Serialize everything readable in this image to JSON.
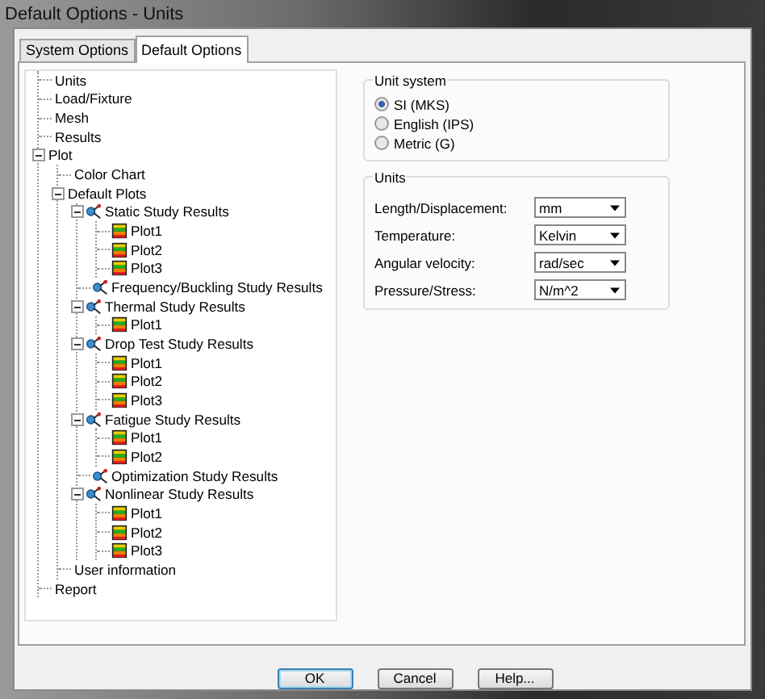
{
  "window": {
    "title": "Default Options - Units"
  },
  "tabs": [
    {
      "label": "System Options",
      "selected": false
    },
    {
      "label": "Default Options",
      "selected": true
    }
  ],
  "tree": [
    {
      "label": "Units"
    },
    {
      "label": "Load/Fixture"
    },
    {
      "label": "Mesh"
    },
    {
      "label": "Results"
    },
    {
      "label": "Plot",
      "expanded": true,
      "children": [
        {
          "label": "Color Chart"
        },
        {
          "label": "Default Plots",
          "expanded": true,
          "children": [
            {
              "label": "Static Study Results",
              "kind": "study",
              "expanded": true,
              "children": [
                {
                  "label": "Plot1",
                  "kind": "plot"
                },
                {
                  "label": "Plot2",
                  "kind": "plot"
                },
                {
                  "label": "Plot3",
                  "kind": "plot"
                }
              ]
            },
            {
              "label": "Frequency/Buckling Study Results",
              "kind": "study"
            },
            {
              "label": "Thermal Study Results",
              "kind": "study",
              "expanded": true,
              "children": [
                {
                  "label": "Plot1",
                  "kind": "plot"
                }
              ]
            },
            {
              "label": "Drop Test Study Results",
              "kind": "study",
              "expanded": true,
              "children": [
                {
                  "label": "Plot1",
                  "kind": "plot"
                },
                {
                  "label": "Plot2",
                  "kind": "plot"
                },
                {
                  "label": "Plot3",
                  "kind": "plot"
                }
              ]
            },
            {
              "label": "Fatigue Study Results",
              "kind": "study",
              "expanded": true,
              "children": [
                {
                  "label": "Plot1",
                  "kind": "plot"
                },
                {
                  "label": "Plot2",
                  "kind": "plot"
                }
              ]
            },
            {
              "label": "Optimization Study Results",
              "kind": "study"
            },
            {
              "label": "Nonlinear Study Results",
              "kind": "study",
              "expanded": true,
              "children": [
                {
                  "label": "Plot1",
                  "kind": "plot"
                },
                {
                  "label": "Plot2",
                  "kind": "plot"
                },
                {
                  "label": "Plot3",
                  "kind": "plot"
                }
              ]
            }
          ]
        },
        {
          "label": "User information"
        }
      ]
    },
    {
      "label": "Report"
    }
  ],
  "unit_system": {
    "title": "Unit system",
    "options": [
      {
        "label": "SI (MKS)",
        "selected": true
      },
      {
        "label": "English (IPS)",
        "selected": false
      },
      {
        "label": "Metric (G)",
        "selected": false
      }
    ]
  },
  "units": {
    "title": "Units",
    "rows": [
      {
        "label": "Length/Displacement:",
        "value": "mm"
      },
      {
        "label": "Temperature:",
        "value": "Kelvin"
      },
      {
        "label": "Angular velocity:",
        "value": "rad/sec"
      },
      {
        "label": "Pressure/Stress:",
        "value": "N/m^2"
      }
    ]
  },
  "buttons": [
    "OK",
    "Cancel",
    "Help..."
  ]
}
